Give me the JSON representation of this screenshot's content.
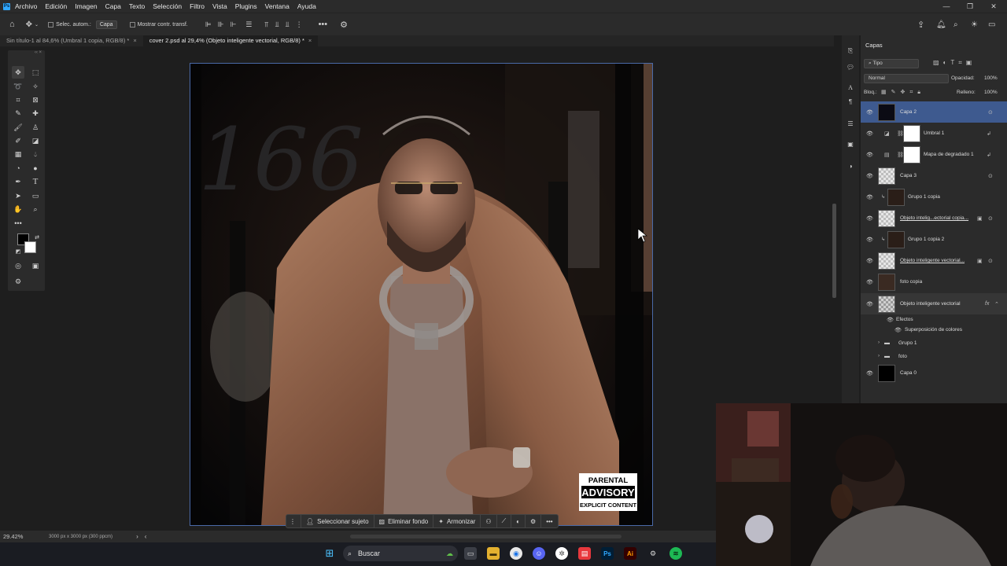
{
  "menubar": {
    "items": [
      "Archivo",
      "Edición",
      "Imagen",
      "Capa",
      "Texto",
      "Selección",
      "Filtro",
      "Vista",
      "Plugins",
      "Ventana",
      "Ayuda"
    ]
  },
  "optionsbar": {
    "auto_select_label": "Selec. autom.:",
    "auto_select_value": "Capa",
    "transform_controls_label": "Mostrar contr. transf."
  },
  "tabs": [
    {
      "label": "Sin título-1 al 84,6% (Umbral 1 copia, RGB/8) *",
      "active": false
    },
    {
      "label": "cover 2.psd al 29,4% (Objeto inteligente vectorial, RGB/8) *",
      "active": true
    }
  ],
  "canvas": {
    "zoom": "29.42%",
    "doc_info": "3000 px x 3000 px (300 ppcm)",
    "advisory_line1": "PARENTAL",
    "advisory_line2": "ADVISORY",
    "advisory_line3": "EXPLICIT CONTENT"
  },
  "contextbar": {
    "select_subject": "Seleccionar sujeto",
    "remove_bg": "Eliminar fondo",
    "harmonize": "Armonizar"
  },
  "layers_panel": {
    "title": "Capas",
    "filter": "Tipo",
    "blend_mode": "Normal",
    "opacity_label": "Opacidad:",
    "opacity_value": "100%",
    "lock_label": "Bloq.:",
    "fill_label": "Relleno:",
    "fill_value": "100%",
    "layers": [
      {
        "name": "Capa 2",
        "selected": true
      },
      {
        "name": "Umbral 1"
      },
      {
        "name": "Mapa de degradado 1"
      },
      {
        "name": "Capa 3"
      },
      {
        "name": "Grupo 1 copia"
      },
      {
        "name": "Objeto intelig...ectorial copia..."
      },
      {
        "name": "Grupo 1 copia 2"
      },
      {
        "name": "Objeto inteligente vectorial..."
      },
      {
        "name": "foto copia"
      },
      {
        "name": "Objeto inteligente vectorial"
      },
      {
        "name": "Efectos"
      },
      {
        "name": "Superposición de colores"
      },
      {
        "name": "Grupo 1"
      },
      {
        "name": "foto"
      },
      {
        "name": "Capa 0"
      }
    ]
  },
  "taskbar": {
    "search_placeholder": "Buscar"
  },
  "colors": {
    "accent": "#3e5a8f",
    "ps_blue": "#31a8ff",
    "canvas_border": "#4a6aa8"
  }
}
